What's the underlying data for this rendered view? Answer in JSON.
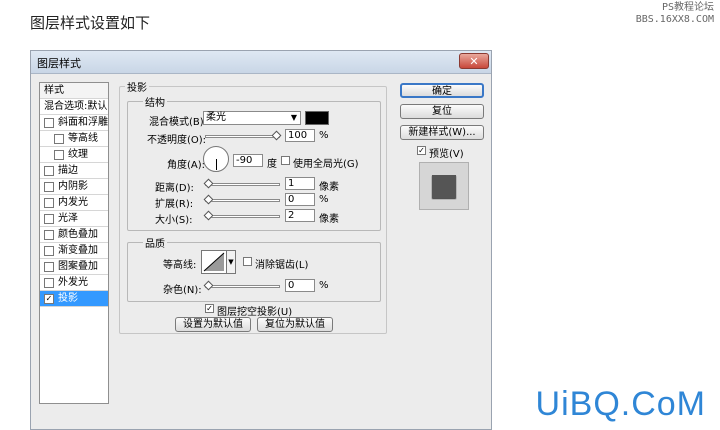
{
  "caption": "图层样式设置如下",
  "watermark_top": [
    "PS教程论坛",
    "BBS.16XX8.COM"
  ],
  "watermark_bottom": "UiBQ.CoM",
  "dialog": {
    "title": "图层样式",
    "close_icon": "close-icon",
    "sidebar": {
      "header": "样式",
      "items": [
        {
          "label": "混合选项:默认",
          "checkbox": false,
          "checked": false,
          "indent": false
        },
        {
          "label": "斜面和浮雕",
          "checkbox": true,
          "checked": false,
          "indent": false
        },
        {
          "label": "等高线",
          "checkbox": true,
          "checked": false,
          "indent": true
        },
        {
          "label": "纹理",
          "checkbox": true,
          "checked": false,
          "indent": true
        },
        {
          "label": "描边",
          "checkbox": true,
          "checked": false,
          "indent": false
        },
        {
          "label": "内阴影",
          "checkbox": true,
          "checked": false,
          "indent": false
        },
        {
          "label": "内发光",
          "checkbox": true,
          "checked": false,
          "indent": false
        },
        {
          "label": "光泽",
          "checkbox": true,
          "checked": false,
          "indent": false
        },
        {
          "label": "颜色叠加",
          "checkbox": true,
          "checked": false,
          "indent": false
        },
        {
          "label": "渐变叠加",
          "checkbox": true,
          "checked": false,
          "indent": false
        },
        {
          "label": "图案叠加",
          "checkbox": true,
          "checked": false,
          "indent": false
        },
        {
          "label": "外发光",
          "checkbox": true,
          "checked": false,
          "indent": false
        },
        {
          "label": "投影",
          "checkbox": true,
          "checked": true,
          "indent": false,
          "selected": true
        }
      ]
    },
    "section_title": "投影",
    "structure": {
      "title": "结构",
      "blend_mode_label": "混合模式(B):",
      "blend_mode_value": "柔光",
      "blend_color": "#000000",
      "opacity_label": "不透明度(O):",
      "opacity_value": "100",
      "opacity_unit": "%",
      "opacity_level": 1.0,
      "angle_label": "角度(A):",
      "angle_value": "-90",
      "angle_unit": "度",
      "global_light_label": "使用全局光(G)",
      "global_light_checked": false,
      "distance_label": "距离(D):",
      "distance_value": "1",
      "distance_unit": "像素",
      "distance_level": 0.0,
      "spread_label": "扩展(R):",
      "spread_value": "0",
      "spread_unit": "%",
      "spread_level": 0.0,
      "size_label": "大小(S):",
      "size_value": "2",
      "size_unit": "像素",
      "size_level": 0.0
    },
    "quality": {
      "title": "品质",
      "contour_label": "等高线:",
      "antialias_label": "消除锯齿(L)",
      "antialias_checked": false,
      "noise_label": "杂色(N):",
      "noise_value": "0",
      "noise_unit": "%",
      "noise_level": 0.0
    },
    "knockout_label": "图层挖空投影(U)",
    "knockout_checked": true,
    "make_default_label": "设置为默认值",
    "reset_default_label": "复位为默认值",
    "ok_label": "确定",
    "reset_label": "复位",
    "new_style_label": "新建样式(W)...",
    "preview_label": "预览(V)",
    "preview_checked": true
  }
}
